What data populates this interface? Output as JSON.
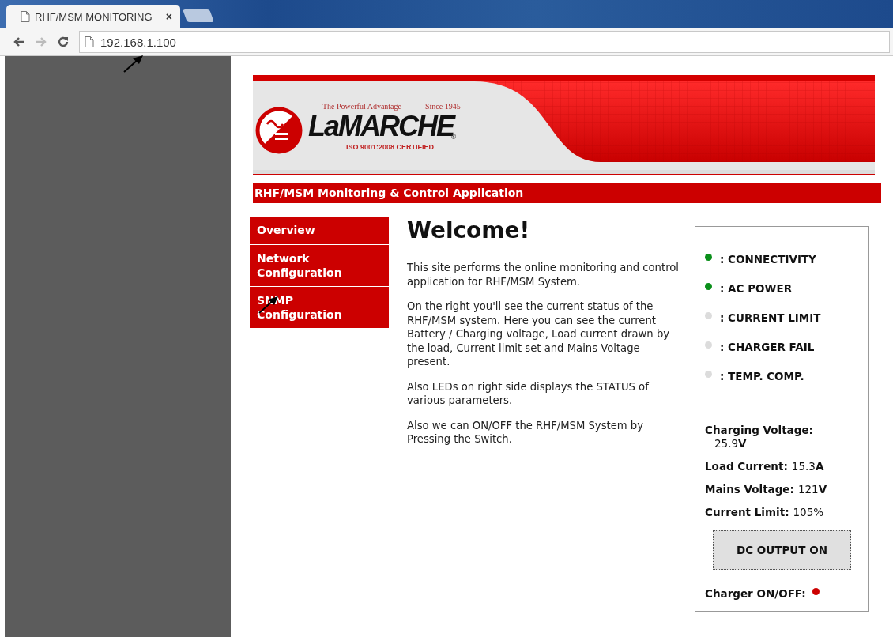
{
  "browser": {
    "tab_title": "RHF/MSM MONITORING",
    "tab_close": "×",
    "url": "192.168.1.100"
  },
  "banner": {
    "tagline": "The Powerful Advantage",
    "since": "Since 1945",
    "brand": "LaMARCHE",
    "registered": "®",
    "certification": "ISO 9001:2008 CERTIFIED"
  },
  "app_title": "RHF/MSM Monitoring & Control Application",
  "nav": [
    {
      "label": "Overview"
    },
    {
      "label": "Network Configuration"
    },
    {
      "label": "SNMP Configuration"
    }
  ],
  "welcome": {
    "heading": "Welcome!",
    "paragraphs": [
      "This site performs the online monitoring and control application for RHF/MSM System.",
      "On the right you'll see the current status of the RHF/MSM system. Here you can see the current Battery / Charging voltage, Load current drawn by the load, Current limit set and Mains Voltage present.",
      "Also LEDs on right side displays the STATUS of various parameters.",
      "Also we can ON/OFF the RHF/MSM System by Pressing the Switch."
    ]
  },
  "status": {
    "leds": [
      {
        "label": ": CONNECTIVITY",
        "on": true
      },
      {
        "label": ": AC POWER",
        "on": true
      },
      {
        "label": ": CURRENT LIMIT",
        "on": false
      },
      {
        "label": ": CHARGER FAIL",
        "on": false
      },
      {
        "label": ": TEMP. COMP.",
        "on": false
      }
    ],
    "readings": [
      {
        "label": "Charging Voltage:",
        "value": "25.9**V**",
        "wrap": true
      },
      {
        "label": "Load Current:",
        "value": "15.3**A**",
        "wrap": false
      },
      {
        "label": "Mains Voltage:",
        "value": "121**V**",
        "wrap": false
      },
      {
        "label": "Current Limit:",
        "value": "105%",
        "wrap": false
      }
    ],
    "output_button": "DC OUTPUT ON",
    "charger": {
      "label": "Charger ON/OFF:",
      "on": true
    }
  }
}
